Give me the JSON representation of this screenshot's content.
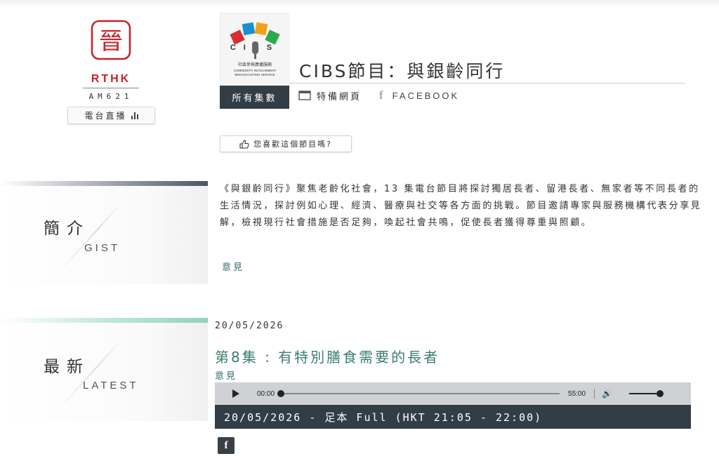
{
  "brand": {
    "logo_char": "晉",
    "name": "RTHK",
    "sub": "AM621",
    "live_label": "電台直播",
    "brand_color": "#c8232c"
  },
  "programme": {
    "logo_word": "CIBS",
    "logo_caption_zh": "社區參與廣播服務",
    "logo_caption_en_1": "COMMUNITY INVOLVEMENT",
    "logo_caption_en_2": "BROADCASTING SERVICE",
    "title": "CIBS節目：與銀齡同行",
    "tabs": {
      "all_episodes": "所有集數",
      "special_page": "特備網頁",
      "facebook": "FACEBOOK"
    },
    "like_prompt": "您喜歡這個節目嗎?"
  },
  "gist": {
    "label_zh": "簡介",
    "label_en": "GIST",
    "text": "《與銀齡同行》聚焦老齡化社會，13 集電台節目將探討獨居長者、留港長者、無家者等不同長者的生活情況，探討例如心理、經濟、醫療與社交等各方面的挑戰。節目邀請專家與服務機構代表分享見解，檢視現行社會措施是否足夠，喚起社會共鳴，促使長者獲得尊重與照顧。",
    "feedback": "意見"
  },
  "latest": {
    "label_zh": "最新",
    "label_en": "LATEST",
    "date": "20/05/2026",
    "episode_title": "第8集 : 有特別膳食需要的長者",
    "feedback": "意見",
    "player": {
      "current_time": "00:00",
      "duration": "55:00",
      "progress_fraction": 0,
      "volume_fraction": 1
    },
    "segment_label": "20/05/2026 - 足本 Full (HKT 21:05 - 22:00)"
  },
  "icons": {
    "fb_letter": "f",
    "volume": "🔊"
  }
}
